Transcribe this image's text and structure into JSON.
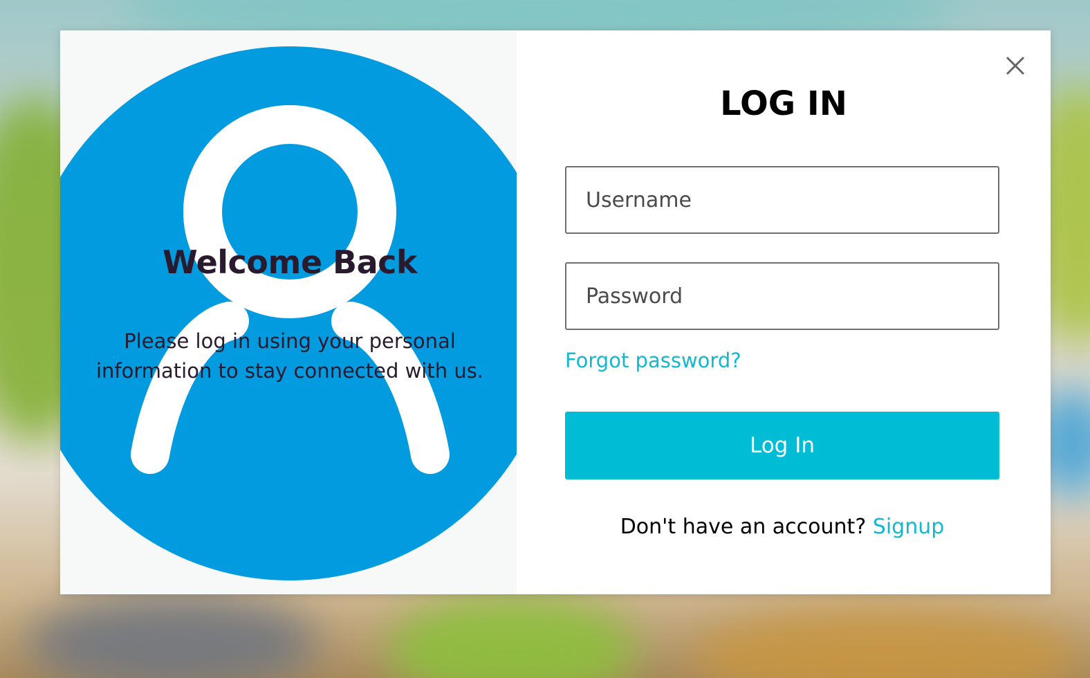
{
  "colors": {
    "accent": "#00bcd4",
    "link": "#13b8d0",
    "avatar_blue": "#039be0",
    "heading_dark": "#2a1a2e"
  },
  "left_panel": {
    "title": "Welcome Back",
    "message": "Please log in using your personal information to stay connected with us.",
    "illustration_icon": "user-avatar-icon"
  },
  "login_form": {
    "close_icon": "close-icon",
    "title": "LOG IN",
    "username_placeholder": "Username",
    "password_placeholder": "Password",
    "forgot_password_link": "Forgot password?",
    "submit_label": "Log In",
    "signup_prompt": "Don't have an account?",
    "signup_link": "Signup"
  }
}
